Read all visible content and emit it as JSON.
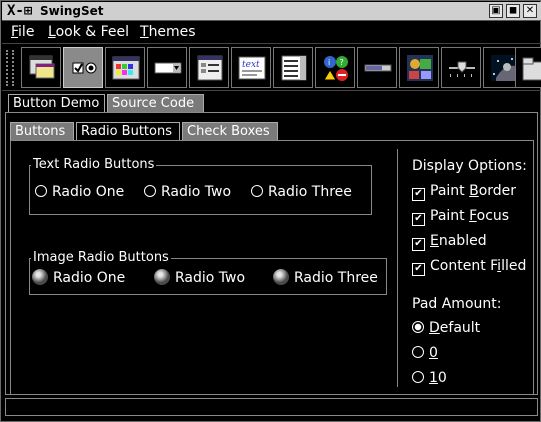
{
  "window": {
    "title": "SwingSet",
    "logo": "X-⊞"
  },
  "titlebar_buttons": [
    "▣",
    "◼",
    "✕"
  ],
  "menubar": {
    "items": [
      {
        "label": "File",
        "mnemonic": "F",
        "rest": "ile"
      },
      {
        "label": "Look & Feel",
        "mnemonic": "L",
        "rest": "ook & Feel"
      },
      {
        "label": "Themes",
        "mnemonic": "T",
        "rest": "hemes"
      }
    ]
  },
  "toolbar": {
    "buttons": [
      {
        "icon": "internal-frame-icon"
      },
      {
        "icon": "button-demo-icon",
        "selected": true
      },
      {
        "icon": "color-chooser-icon"
      },
      {
        "icon": "combobox-icon"
      },
      {
        "icon": "file-chooser-icon"
      },
      {
        "icon": "html-icon"
      },
      {
        "icon": "list-icon"
      },
      {
        "icon": "option-pane-icon"
      },
      {
        "icon": "progress-bar-icon"
      },
      {
        "icon": "scroll-pane-icon"
      },
      {
        "icon": "slider-icon"
      },
      {
        "icon": "split-pane-icon"
      },
      {
        "icon": "tabbed-pane-icon"
      }
    ]
  },
  "outer_tabs": [
    "Button Demo",
    "Source Code"
  ],
  "inner_tabs": [
    "Buttons",
    "Radio Buttons",
    "Check Boxes"
  ],
  "text_group": {
    "title": "Text Radio Buttons",
    "items": [
      "Radio One",
      "Radio Two",
      "Radio Three"
    ]
  },
  "image_group": {
    "title": "Image Radio Buttons",
    "items": [
      "Radio One",
      "Radio Two",
      "Radio Three"
    ]
  },
  "display_options": {
    "title": "Display Options:",
    "items": [
      {
        "label": "Paint Border",
        "pre": "Paint ",
        "mn": "B",
        "post": "order",
        "checked": true
      },
      {
        "label": "Paint Focus",
        "pre": "Paint ",
        "mn": "F",
        "post": "ocus",
        "checked": true
      },
      {
        "label": "Enabled",
        "pre": "",
        "mn": "E",
        "post": "nabled",
        "checked": true
      },
      {
        "label": "Content Filled",
        "pre": "Content F",
        "mn": "i",
        "post": "lled",
        "checked": true
      }
    ]
  },
  "pad_amount": {
    "title": "Pad Amount:",
    "items": [
      {
        "label": "Default",
        "mn": "D",
        "post": "efault",
        "selected": true
      },
      {
        "label": "0",
        "mn": "0",
        "post": "",
        "selected": false
      },
      {
        "label": "10",
        "mn": "1",
        "post": "0",
        "selected": false
      }
    ]
  },
  "check_glyph": "✔"
}
